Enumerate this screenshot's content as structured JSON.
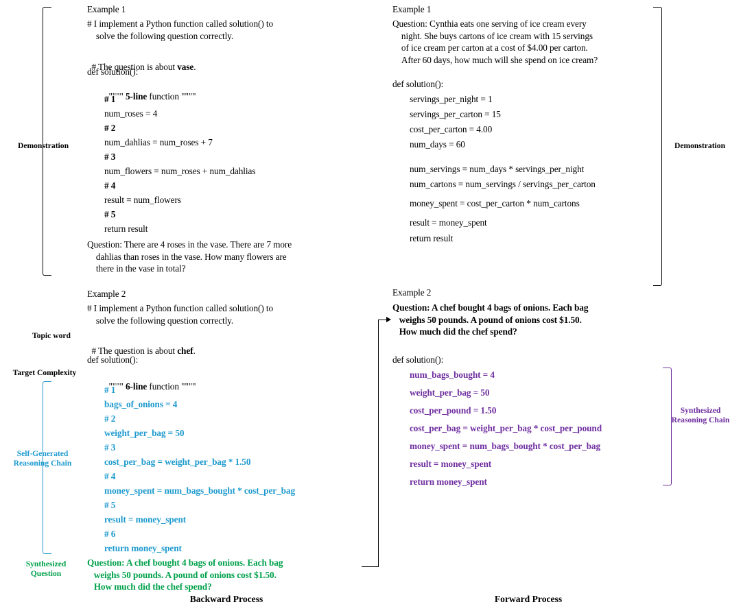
{
  "captions": {
    "backward": "Backward Process",
    "forward": "Forward Process"
  },
  "labels": {
    "demonstration_left": "Demonstration",
    "demonstration_right": "Demonstration",
    "topic_word": "Topic word",
    "target_complexity": "Target Complexity",
    "self_generated_reasoning_chain": "Self-Generated\nReasoning Chain",
    "synthesized_question": "Synthesized\nQuestion",
    "synthesized_reasoning_chain": "Synthesized\nReasoning Chain"
  },
  "left_column": {
    "example1": {
      "header": "Example 1",
      "comment1": "# I implement a Python function called solution() to\n    solve the following question correctly.",
      "topic_line_prefix": "# The question is about ",
      "topic_word": "vase",
      "topic_line_suffix": ".",
      "def_line": "def solution():",
      "docstring_prefix": "\"\"\"\" ",
      "docstring_bold": "5-line",
      "docstring_suffix": " function \"\"\"\"",
      "code_lines": [
        "# 1",
        "num_roses = 4",
        "# 2",
        "num_dahlias = num_roses + 7",
        "# 3",
        "num_flowers = num_roses + num_dahlias",
        "# 4",
        "result = num_flowers",
        "# 5",
        "return result"
      ],
      "code_bold_flags": [
        true,
        false,
        true,
        false,
        true,
        false,
        true,
        false,
        true,
        false
      ],
      "question": "Question: There are 4 roses in the vase. There are 7 more\n    dahlias than roses in the vase. How many flowers are\n    there in the vase in total?"
    },
    "example2": {
      "header": "Example 2",
      "comment1": "# I implement a Python function called solution() to\n    solve the following question correctly.",
      "topic_line_prefix": "# The question is about ",
      "topic_word": "chef",
      "topic_line_suffix": ".",
      "def_line": "def solution():",
      "docstring_prefix": "\"\"\"\" ",
      "docstring_bold": "6-line",
      "docstring_suffix": " function \"\"\"\"",
      "code_lines": [
        "# 1",
        "bags_of_onions = 4",
        "# 2",
        "weight_per_bag = 50",
        "# 3",
        "cost_per_bag = weight_per_bag * 1.50",
        "# 4",
        "money_spent = num_bags_bought * cost_per_bag",
        "# 5",
        "result = money_spent",
        "# 6",
        "return money_spent"
      ],
      "question": "Question: A chef bought 4 bags of onions. Each bag\n   weighs 50 pounds. A pound of onions cost $1.50.\n   How much did the chef spend?"
    }
  },
  "right_column": {
    "example1": {
      "header": "Example 1",
      "question": "Question: Cynthia eats one serving of ice cream every\n    night. She buys cartons of ice cream with 15 servings\n    of ice cream per carton at a cost of $4.00 per carton.\n    After 60 days, how much will she spend on ice cream?",
      "def_line": "def solution():",
      "code_lines": [
        "servings_per_night = 1",
        "servings_per_carton = 15",
        "cost_per_carton = 4.00",
        "num_days = 60",
        "num_servings = num_days * servings_per_night",
        "num_cartons = num_servings / servings_per_carton",
        "money_spent = cost_per_carton * num_cartons",
        "result = money_spent",
        "return result"
      ]
    },
    "example2": {
      "header": "Example 2",
      "question": "Question: A chef bought 4 bags of onions. Each bag\n   weighs 50 pounds. A pound of onions cost $1.50.\n   How much did the chef spend?",
      "def_line": "def solution():",
      "code_lines": [
        "num_bags_bought = 4",
        "weight_per_bag = 50",
        "cost_per_pound = 1.50",
        "cost_per_bag = weight_per_bag * cost_per_pound",
        "money_spent = num_bags_bought * cost_per_bag",
        "result = money_spent",
        "return money_spent"
      ]
    }
  },
  "colors": {
    "blue": "#1f9bcf",
    "green": "#00a14b",
    "purple": "#7030a0",
    "black": "#000000"
  }
}
